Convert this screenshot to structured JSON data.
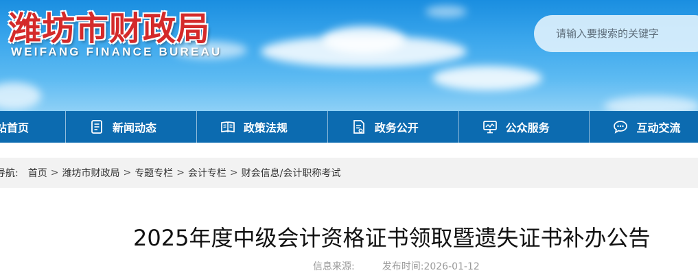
{
  "site": {
    "title": "潍坊市财政局",
    "subtitle": "WEIFANG  FINANCE  BUREAU"
  },
  "search": {
    "placeholder": "请输入要搜索的关键字"
  },
  "nav": {
    "items": [
      {
        "label": "站首页",
        "icon": "none"
      },
      {
        "label": "新闻动态",
        "icon": "document-icon"
      },
      {
        "label": "政策法规",
        "icon": "book-icon"
      },
      {
        "label": "政务公开",
        "icon": "file-check-icon"
      },
      {
        "label": "公众服务",
        "icon": "monitor-icon"
      },
      {
        "label": "互动交流",
        "icon": "chat-icon"
      }
    ]
  },
  "breadcrumb": {
    "prefix": "导航:",
    "items": [
      "首页",
      "潍坊市财政局",
      "专题专栏",
      "会计专栏",
      "财会信息/会计职称考试"
    ],
    "separator": ">"
  },
  "article": {
    "title": "2025年度中级会计资格证书领取暨遗失证书补办公告",
    "source_label": "信息来源:",
    "date_label": "发布时间:",
    "date": "2026-01-12"
  },
  "colors": {
    "nav_bg": "#0c6bb0",
    "title_red": "#d42a2a",
    "breadcrumb_bg": "#f2f2f2"
  }
}
